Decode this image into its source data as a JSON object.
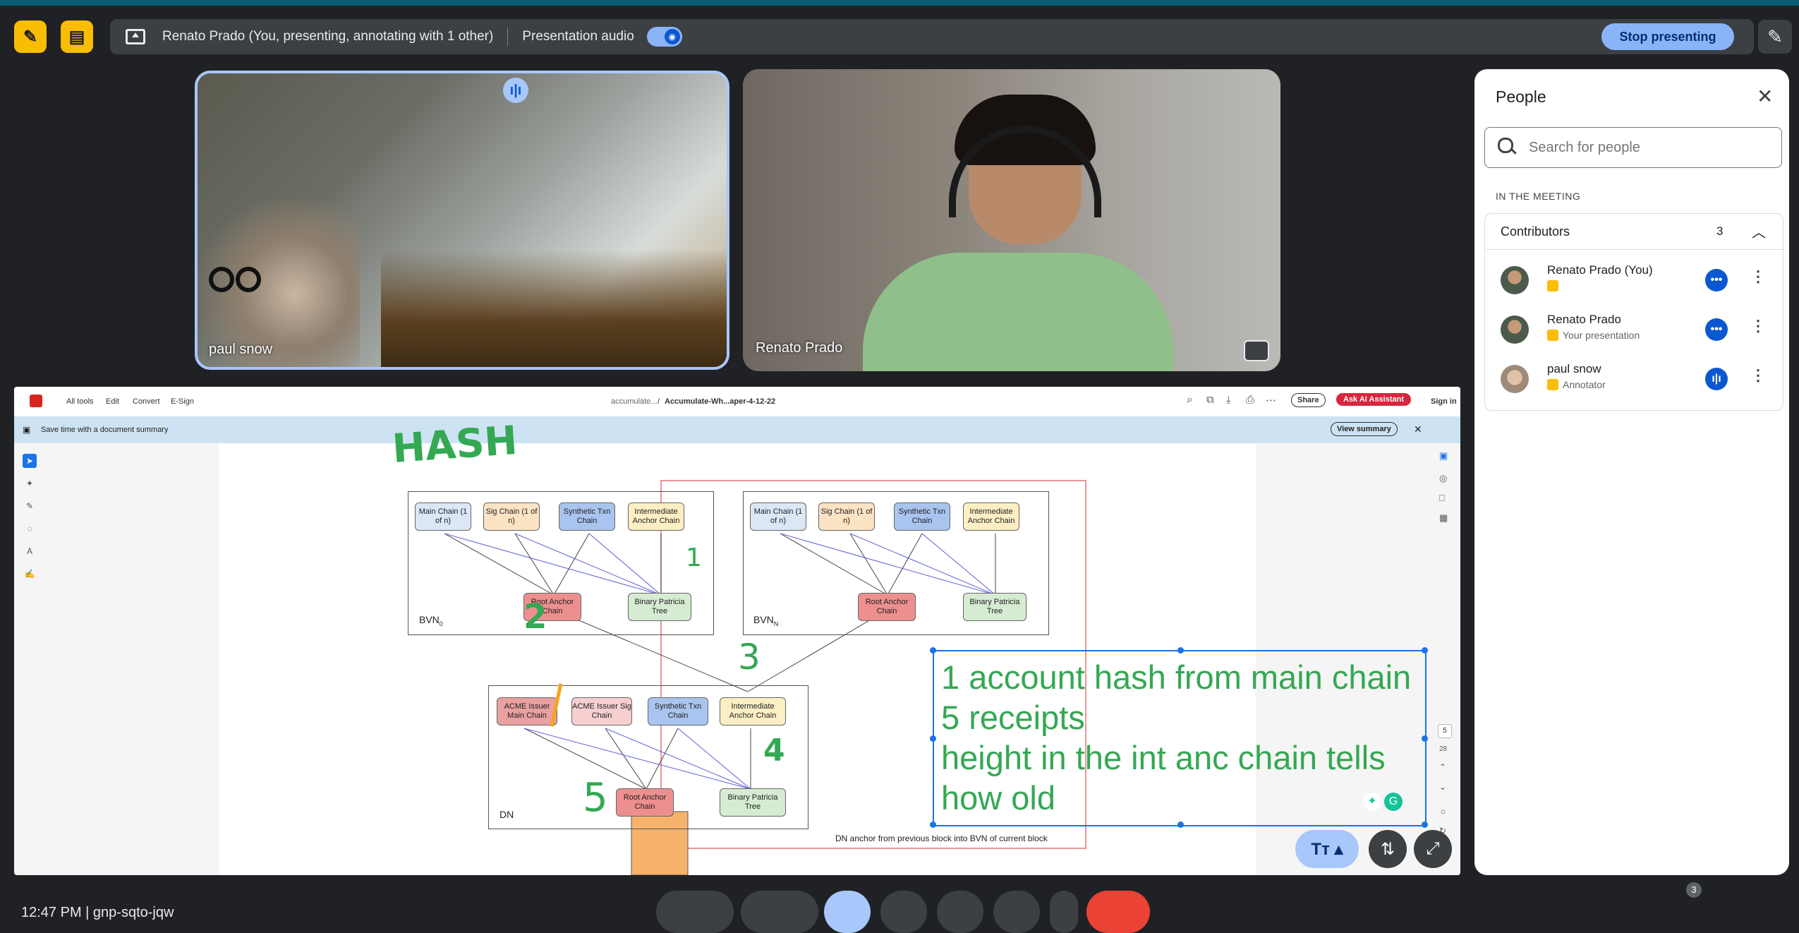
{
  "presenting_bar": {
    "status_text": "Renato Prado (You, presenting, annotating with 1 other)",
    "audio_label": "Presentation audio",
    "stop_label": "Stop presenting"
  },
  "tiles": [
    {
      "name": "paul snow"
    },
    {
      "name": "Renato Prado"
    }
  ],
  "pdf": {
    "menu": [
      "All tools",
      "Edit",
      "Convert",
      "E-Sign"
    ],
    "breadcrumb": "accumulate...",
    "doc_name": "Accumulate-Wh...aper-4-12-22",
    "share_label": "Share",
    "ai_label": "Ask AI Assistant",
    "signin_label": "Sign in",
    "banner_text": "Save time with a document summary",
    "view_summary_label": "View summary",
    "page_number": "5",
    "page_total": "28",
    "diagram": {
      "bvn0": {
        "label": "BVN",
        "sub": "0",
        "boxes": [
          "Main Chain (1 of n)",
          "Sig Chain (1 of n)",
          "Synthetic Txn Chain",
          "Intermediate Anchor Chain"
        ],
        "root": "Root Anchor Chain",
        "tree": "Binary Patricia Tree"
      },
      "bvnN": {
        "label": "BVN",
        "sub": "N",
        "boxes": [
          "Main Chain (1 of n)",
          "Sig Chain (1 of n)",
          "Synthetic Txn Chain",
          "Intermediate Anchor Chain"
        ],
        "root": "Root Anchor Chain",
        "tree": "Binary Patricia Tree"
      },
      "dn": {
        "label": "DN",
        "boxes": [
          "ACME Issuer Main Chain",
          "ACME Issuer Sig Chain",
          "Synthetic Txn Chain",
          "Intermediate Anchor Chain"
        ],
        "root": "Root Anchor Chain",
        "tree": "Binary Patricia Tree"
      },
      "caption": "DN anchor from previous block into BVN of current block"
    },
    "annotations": {
      "hash": "HASH",
      "nums": [
        "1",
        "2",
        "3",
        "4",
        "5"
      ],
      "textbox_lines": [
        "1 account hash from main chain",
        "5 receipts",
        "height in the int anc chain tells",
        "how old"
      ]
    }
  },
  "people": {
    "title": "People",
    "search_placeholder": "Search for people",
    "section": "IN THE MEETING",
    "group_label": "Contributors",
    "group_count": "3",
    "members": [
      {
        "name": "Renato Prado (You)",
        "role": ""
      },
      {
        "name": "Renato Prado",
        "role": "Your presentation"
      },
      {
        "name": "paul snow",
        "role": "Annotator"
      }
    ]
  },
  "bottom": {
    "time": "12:47 PM",
    "meeting_code": "gnp-sqto-jqw",
    "participants_badge": "3"
  },
  "colors": {
    "accent": "#8ab4f8",
    "annotation_green": "#34a853",
    "selection_blue": "#1a73e8",
    "adobe_red": "#d7261f"
  }
}
